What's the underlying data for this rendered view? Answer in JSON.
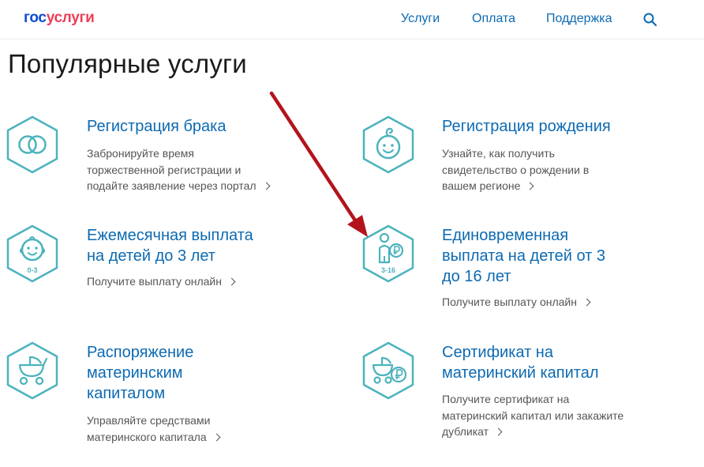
{
  "header": {
    "logo_part1": "гос",
    "logo_part2": "услуги",
    "nav": [
      "Услуги",
      "Оплата",
      "Поддержка"
    ]
  },
  "page": {
    "title": "Популярные услуги"
  },
  "services": [
    {
      "title": "Регистрация брака",
      "desc": [
        "Забронируйте время",
        "торжественной регистрации и",
        "подайте заявление через портал"
      ],
      "icon": "rings-icon"
    },
    {
      "title": "Регистрация рождения",
      "desc": [
        "Узнайте, как получить",
        "свидетельство о рождении в",
        "вашем регионе"
      ],
      "icon": "baby-face-icon"
    },
    {
      "title_lines": [
        "Ежемесячная выплата",
        "на детей до 3 лет"
      ],
      "desc": [
        "Получите выплату онлайн"
      ],
      "icon": "baby-0-3-icon",
      "icon_label": "0-3"
    },
    {
      "title_lines": [
        "Единовременная",
        "выплата на детей от 3",
        "до 16 лет"
      ],
      "desc": [
        "Получите выплату онлайн"
      ],
      "icon": "child-ruble-3-16-icon",
      "icon_label": "3-16"
    },
    {
      "title_lines": [
        "Распоряжение",
        "материнским",
        "капиталом"
      ],
      "desc": [
        "Управляйте средствами",
        "материнского капитала"
      ],
      "icon": "stroller-icon"
    },
    {
      "title_lines": [
        "Сертификат на",
        "материнский капитал"
      ],
      "desc": [
        "Получите сертификат на",
        "материнский капитал или закажите",
        "дубликат"
      ],
      "icon": "stroller-ruble-icon"
    }
  ],
  "colors": {
    "accent": "#0d6ab2",
    "icon": "#4bb3bd",
    "logo_blue": "#0d4cd3",
    "logo_red": "#ee3f58",
    "arrow": "#b3141c"
  }
}
